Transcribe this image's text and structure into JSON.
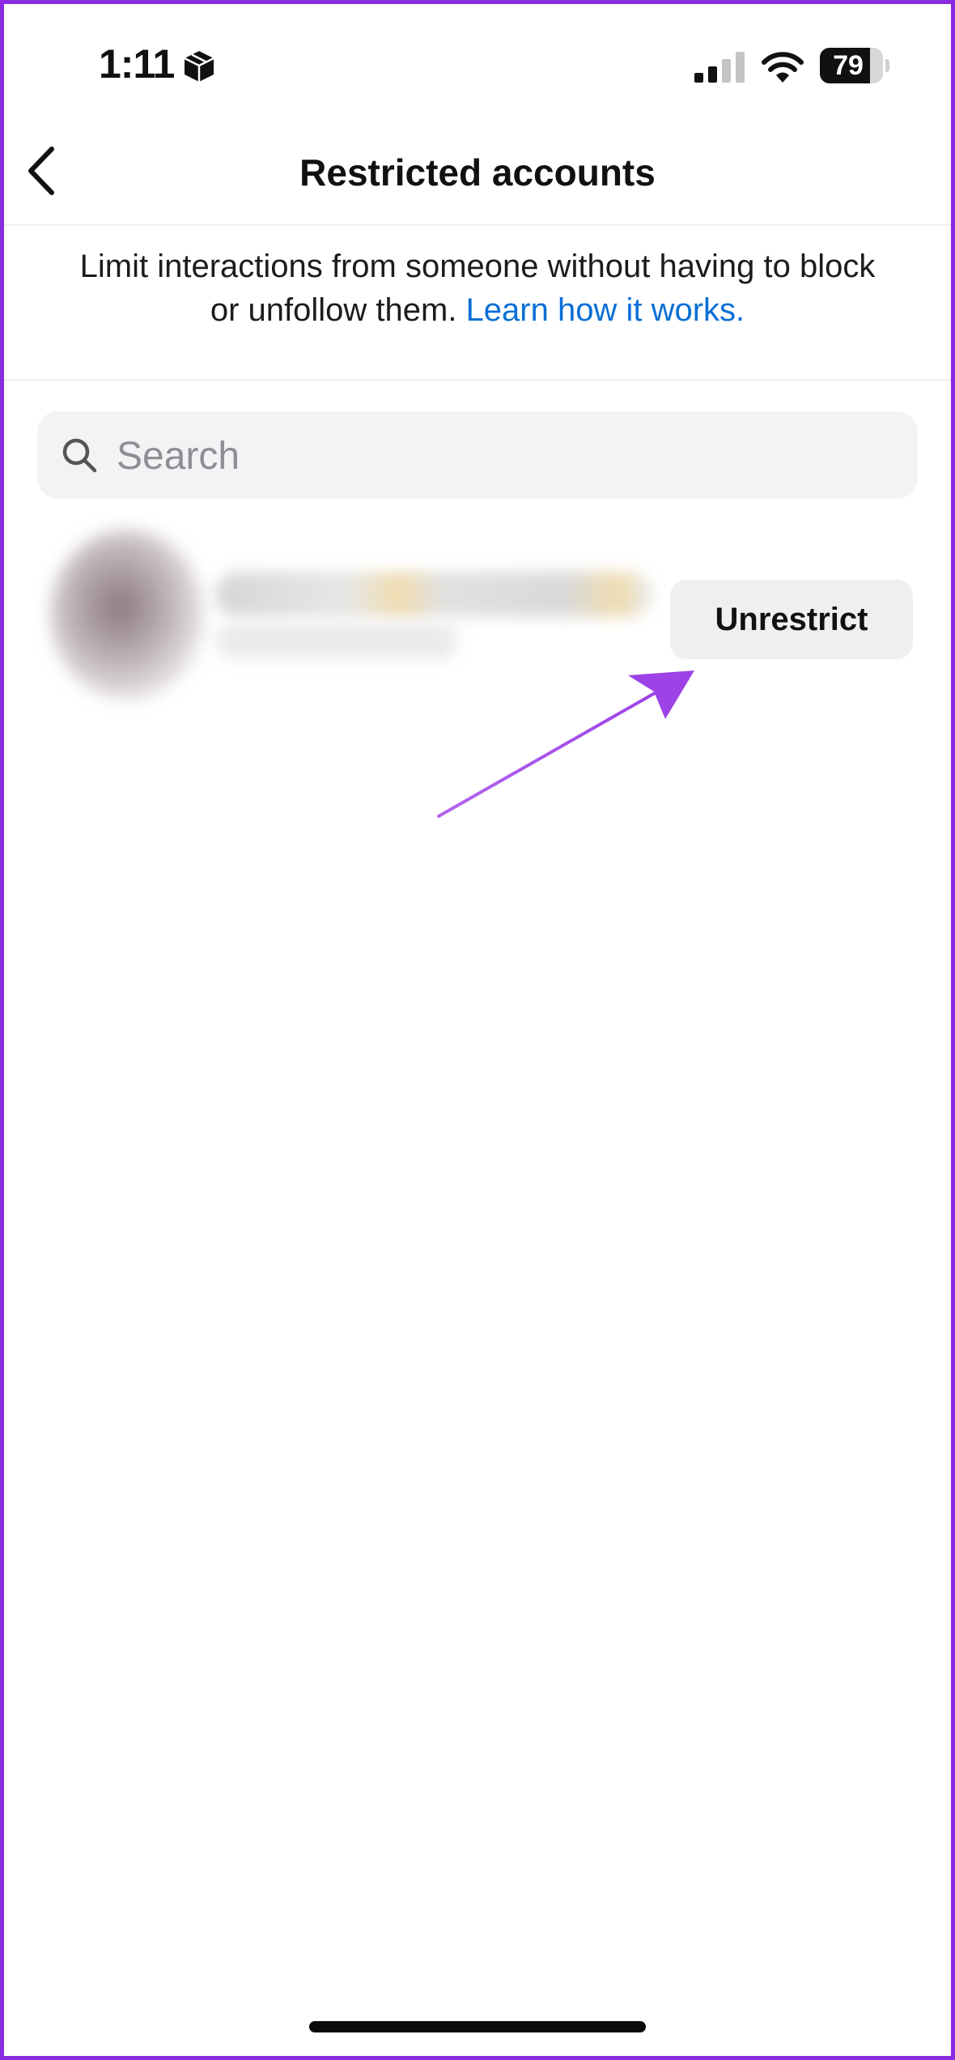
{
  "status_bar": {
    "time": "1:11",
    "battery_level": "79",
    "battery_percent": 79,
    "signal_bars_active": 2,
    "signal_bars_total": 4
  },
  "header": {
    "title": "Restricted accounts"
  },
  "description": {
    "text": "Limit interactions from someone without having to block or unfollow them.",
    "link_text": "Learn how it works."
  },
  "search": {
    "placeholder": "Search",
    "value": ""
  },
  "accounts": [
    {
      "name": "",
      "handle": "",
      "action_label": "Unrestrict"
    }
  ],
  "colors": {
    "link": "#0a6fd6",
    "annotation_arrow": "#a24ce8",
    "frame_border": "#8a2be2"
  },
  "icons": {
    "status": "box-icon",
    "signal": "cellular-signal-icon",
    "wifi": "wifi-icon",
    "back": "chevron-left-icon",
    "search": "search-icon",
    "annotation": "arrow-icon"
  }
}
